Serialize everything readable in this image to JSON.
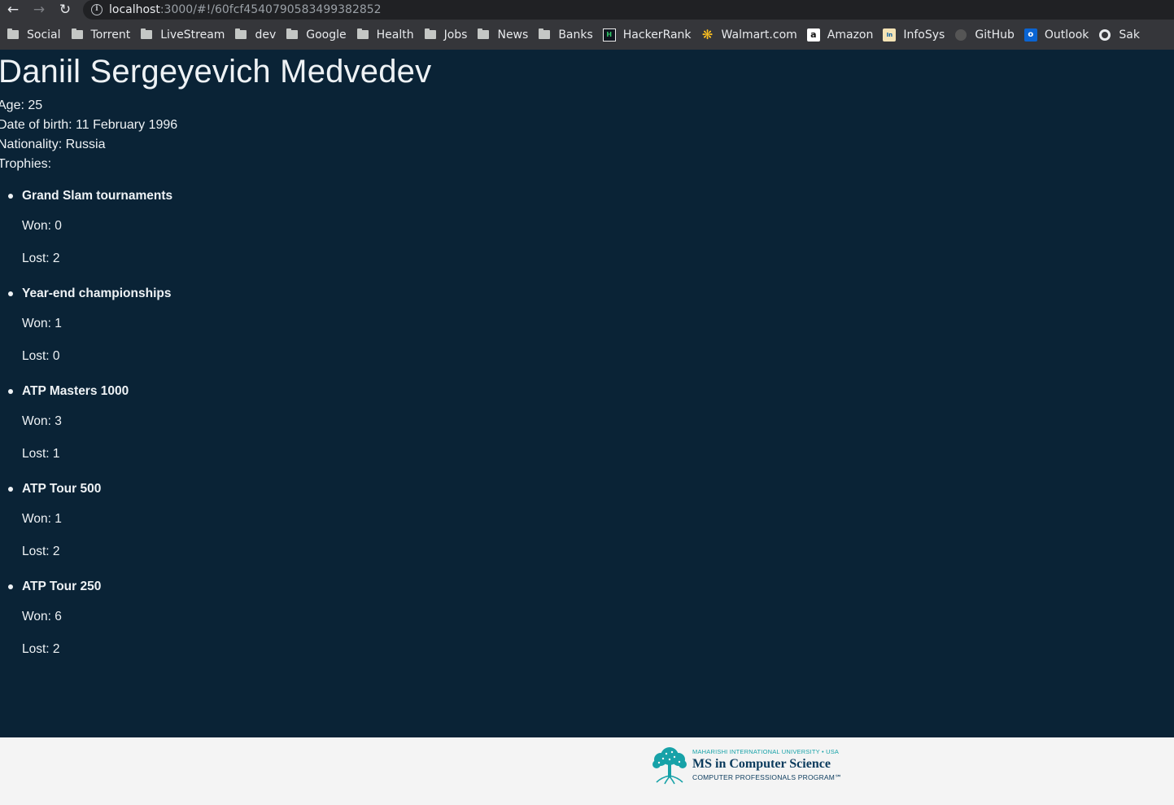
{
  "browser": {
    "url_host": "localhost",
    "url_path": ":3000/#!/60fcf4540790583499382852",
    "bookmarks": [
      {
        "label": "Social",
        "icon": "folder-icon"
      },
      {
        "label": "Torrent",
        "icon": "folder-icon"
      },
      {
        "label": "LiveStream",
        "icon": "folder-icon"
      },
      {
        "label": "dev",
        "icon": "folder-icon"
      },
      {
        "label": "Google",
        "icon": "folder-icon"
      },
      {
        "label": "Health",
        "icon": "folder-icon"
      },
      {
        "label": "Jobs",
        "icon": "folder-icon"
      },
      {
        "label": "News",
        "icon": "folder-icon"
      },
      {
        "label": "Banks",
        "icon": "folder-icon"
      },
      {
        "label": "HackerRank",
        "icon": "hackerrank-icon"
      },
      {
        "label": "Walmart.com",
        "icon": "walmart-icon"
      },
      {
        "label": "Amazon",
        "icon": "amazon-icon"
      },
      {
        "label": "InfoSys",
        "icon": "infosys-icon"
      },
      {
        "label": "GitHub",
        "icon": "github-icon"
      },
      {
        "label": "Outlook",
        "icon": "outlook-icon"
      },
      {
        "label": "Sak",
        "icon": "globe-icon"
      }
    ]
  },
  "player": {
    "name": "Daniil Sergeyevich Medvedev",
    "age_line": "Age: 25",
    "dob_line": "Date of birth: 11 February 1996",
    "nationality_line": "Nationality: Russia",
    "trophies_label": "Trophies:",
    "trophies": [
      {
        "name": "Grand Slam tournaments",
        "won": "Won: 0",
        "lost": "Lost: 2"
      },
      {
        "name": "Year-end championships",
        "won": "Won: 1",
        "lost": "Lost: 0"
      },
      {
        "name": "ATP Masters 1000",
        "won": "Won: 3",
        "lost": "Lost: 1"
      },
      {
        "name": "ATP Tour 500",
        "won": "Won: 1",
        "lost": "Lost: 2"
      },
      {
        "name": "ATP Tour 250",
        "won": "Won: 6",
        "lost": "Lost: 2"
      }
    ]
  },
  "footer": {
    "logo_university": "MAHARISHI INTERNATIONAL UNIVERSITY • USA",
    "logo_title": "MS in Computer Science",
    "logo_subtitle": "COMPUTER PROFESSIONALS PROGRAM℠"
  },
  "colors": {
    "page_background": "#0a2336",
    "footer_background": "#f4f4f4",
    "logo_teal": "#17a2a8",
    "logo_navy": "#0a3a5c"
  }
}
